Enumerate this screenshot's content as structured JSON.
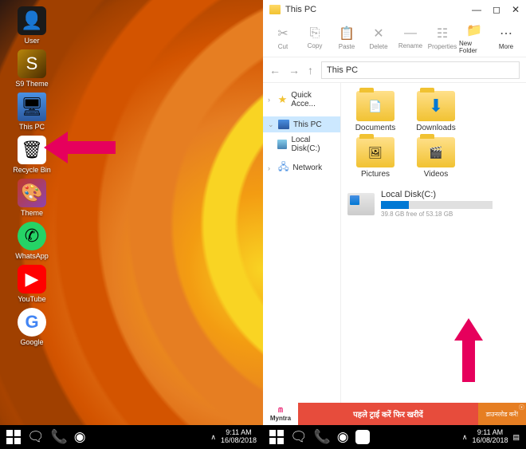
{
  "desktop_icons": [
    {
      "label": "User",
      "type": "user"
    },
    {
      "label": "S9 Theme",
      "type": "s9"
    },
    {
      "label": "This PC",
      "type": "thispc"
    },
    {
      "label": "Recycle Bin",
      "type": "bin"
    },
    {
      "label": "Theme",
      "type": "theme"
    },
    {
      "label": "WhatsApp",
      "type": "whatsapp"
    },
    {
      "label": "YouTube",
      "type": "youtube"
    },
    {
      "label": "Google",
      "type": "google"
    }
  ],
  "taskbar": {
    "time": "9:11 AM",
    "date": "16/08/2018"
  },
  "explorer": {
    "title": "This PC",
    "toolbar": [
      {
        "label": "Cut",
        "icon": "✂"
      },
      {
        "label": "Copy",
        "icon": "⎘"
      },
      {
        "label": "Paste",
        "icon": "📋"
      },
      {
        "label": "Delete",
        "icon": "✕"
      },
      {
        "label": "Rename",
        "icon": "—"
      },
      {
        "label": "Properties",
        "icon": "☷"
      },
      {
        "label": "New Folder",
        "icon": "📁",
        "dark": true
      },
      {
        "label": "More",
        "icon": "⋯",
        "dark": true
      }
    ],
    "path": "This PC",
    "sidebar": [
      {
        "label": "Quick Acce...",
        "type": "star",
        "chev": true
      },
      {
        "label": "This PC",
        "type": "pc",
        "sel": true,
        "chev": true
      },
      {
        "label": "Local Disk(C:)",
        "type": "disk"
      },
      {
        "label": "Network",
        "type": "net",
        "chev": true
      }
    ],
    "folders": [
      {
        "label": "Documents",
        "overlay": "doc"
      },
      {
        "label": "Downloads",
        "overlay": "dl"
      },
      {
        "label": "Pictures",
        "overlay": "pic"
      },
      {
        "label": "Videos",
        "overlay": "vid"
      }
    ],
    "drive": {
      "name": "Local Disk(C:)",
      "free": "39.8 GB free of 53.18 GB"
    }
  },
  "ad": {
    "logo": "Myntra",
    "text1": "पहले ट्राई करें फिर खरीदें",
    "text2": "डाउनलोड करें!"
  }
}
